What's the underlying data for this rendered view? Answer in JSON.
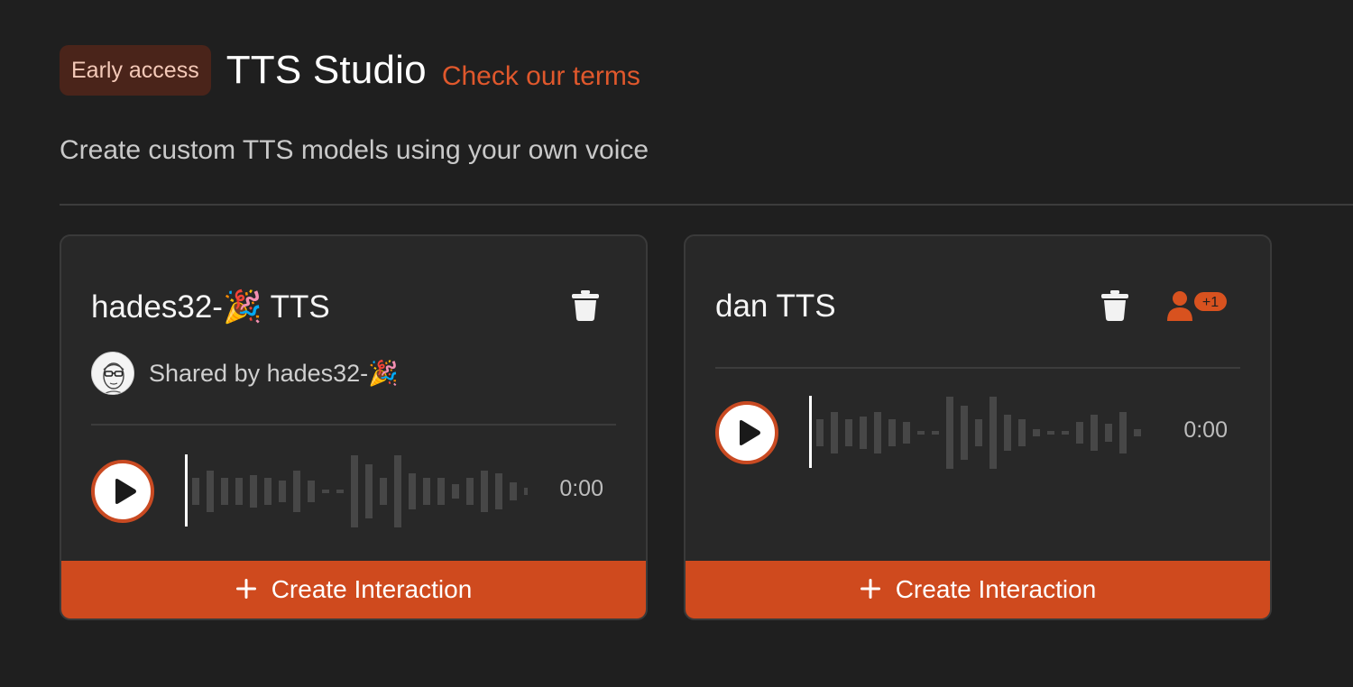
{
  "header": {
    "badge": "Early access",
    "title": "TTS Studio",
    "terms_link": "Check our terms",
    "subtitle": "Create custom TTS models using your own voice"
  },
  "colors": {
    "background": "#1f1f1f",
    "card": "#282828",
    "accent": "#cf4a1e",
    "link": "#e0582c"
  },
  "cards": [
    {
      "title": "hades32-🎉 TTS",
      "shared_by": "Shared by hades32-🎉",
      "time": "0:00",
      "create_label": "Create Interaction",
      "icons": [
        "trash-icon",
        "avatar",
        "play-icon",
        "plus-icon"
      ]
    },
    {
      "title": "dan TTS",
      "time": "0:00",
      "share_count": "+1",
      "create_label": "Create Interaction",
      "icons": [
        "trash-icon",
        "share-user-icon",
        "play-icon",
        "plus-icon"
      ]
    }
  ]
}
